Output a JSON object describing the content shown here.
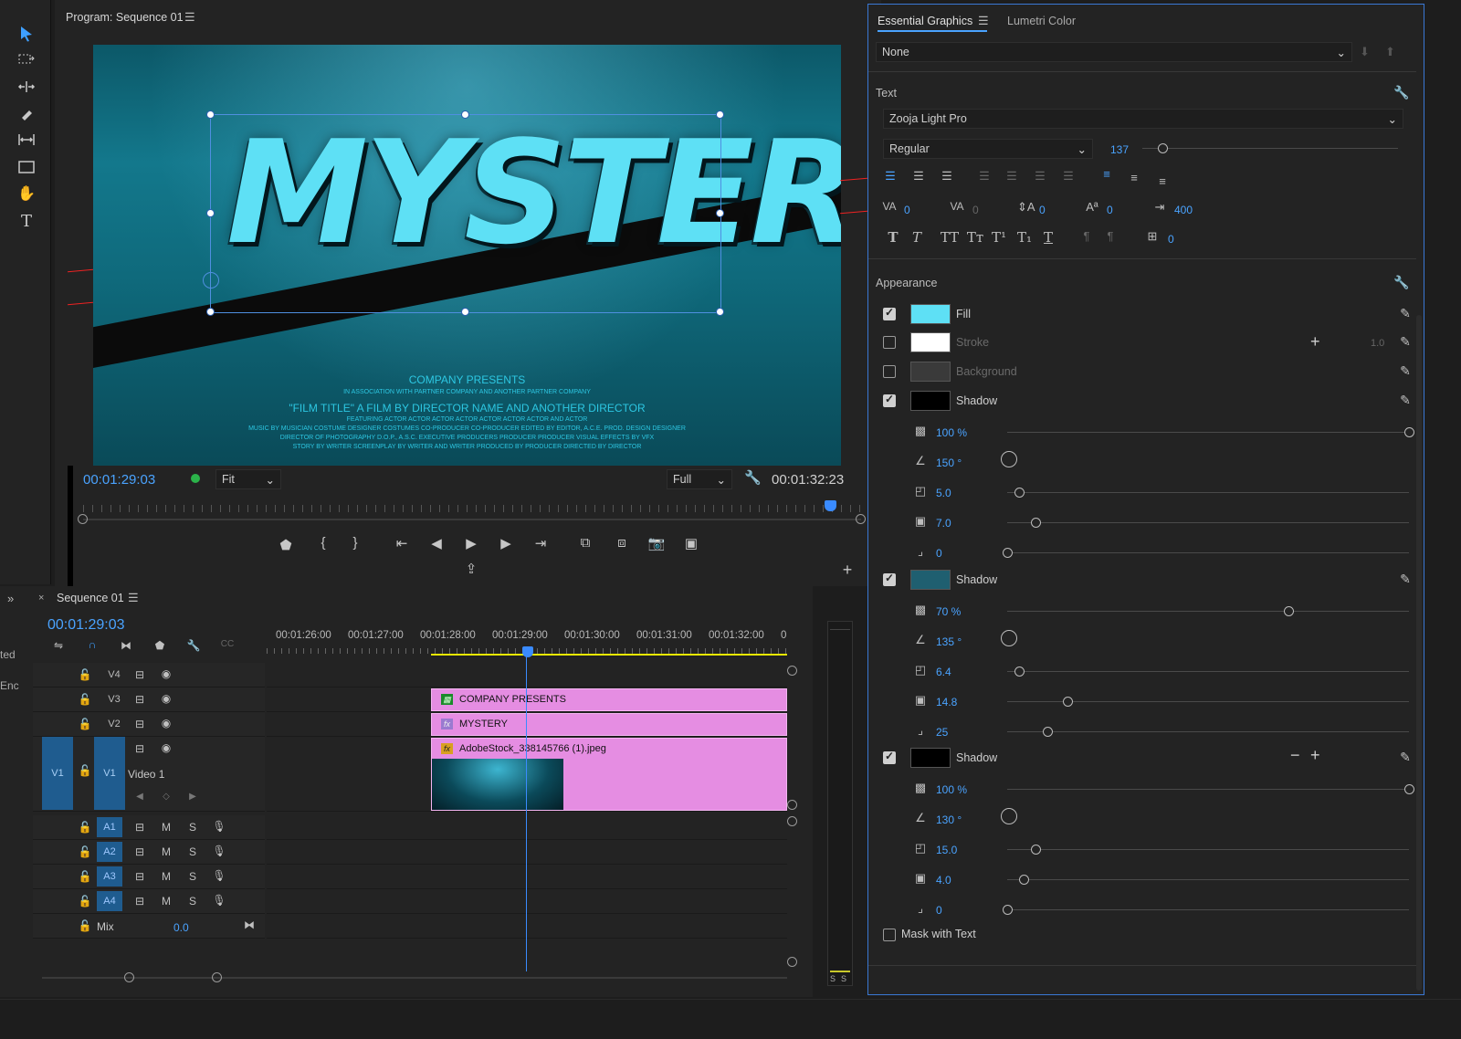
{
  "monitor": {
    "title": "Program: Sequence 01",
    "video_title": "MYSTERY",
    "credits": {
      "l1": "COMPANY PRESENTS",
      "l2": "IN ASSOCIATION WITH PARTNER COMPANY AND ANOTHER PARTNER COMPANY",
      "l3": "\"FILM TITLE\" A FILM BY DIRECTOR NAME AND ANOTHER DIRECTOR",
      "l4": "FEATURING ACTOR ACTOR ACTOR ACTOR ACTOR ACTOR ACTOR AND ACTOR",
      "l5": "MUSIC BY MUSICIAN COSTUME DESIGNER COSTUMES CO-PRODUCER CO-PRODUCER EDITED BY EDITOR, A.C.E.   PROD. DESIGN DESIGNER",
      "l6": "DIRECTOR OF PHOTOGRAPHY D.O.P., A.S.C.  EXECUTIVE PRODUCERS PRODUCER PRODUCER VISUAL EFFECTS BY VFX",
      "l7": "STORY BY WRITER SCREENPLAY BY WRITER AND WRITER PRODUCED BY PRODUCER DIRECTED BY DIRECTOR"
    },
    "timecode_current": "00:01:29:03",
    "zoom": "Fit",
    "quality": "Full",
    "timecode_duration": "00:01:32:23"
  },
  "timeline": {
    "title": "Sequence 01",
    "timecode": "00:01:29:03",
    "ruler": [
      "00:01:26:00",
      "00:01:27:00",
      "00:01:28:00",
      "00:01:29:00",
      "00:01:30:00",
      "00:01:31:00",
      "00:01:32:00",
      "0"
    ],
    "video_tracks": [
      "V4",
      "V3",
      "V2",
      "V1"
    ],
    "source_patch": "V1",
    "video1_name": "Video 1",
    "audio_tracks": [
      "A1",
      "A2",
      "A3",
      "A4"
    ],
    "audio_m": "M",
    "audio_s": "S",
    "mix_label": "Mix",
    "mix_value": "0.0",
    "clips": {
      "v3": "COMPANY PRESENTS",
      "v2": "MYSTERY",
      "v1": "AdobeStock_338145766 (1).jpeg"
    },
    "left_cut_1": "ted",
    "left_cut_2": "Enc",
    "meter_s1": "S",
    "meter_s2": "S"
  },
  "eg": {
    "tab_active": "Essential Graphics",
    "tab_other": "Lumetri Color",
    "style_select": "None",
    "text_section": "Text",
    "font": "Zooja Light Pro",
    "font_style": "Regular",
    "font_size": "137",
    "font_size_frac": 0.08,
    "kerning": "0",
    "tracking": "0",
    "leading": "0",
    "baseline": "0",
    "tab_width": "400",
    "tsume": "0",
    "appearance": "Appearance",
    "fill_label": "Fill",
    "stroke_label": "Stroke",
    "stroke_width": "1.0",
    "background_label": "Background",
    "shadow_label": "Shadow",
    "shadow1": {
      "opacity": "100 %",
      "angle": "150 °",
      "distance": "5.0",
      "size": "7.0",
      "blur": "0",
      "opacity_frac": 1.0,
      "distance_frac": 0.03,
      "size_frac": 0.07,
      "blur_frac": 0.0
    },
    "shadow2": {
      "opacity": "70 %",
      "angle": "135 °",
      "distance": "6.4",
      "size": "14.8",
      "blur": "25",
      "opacity_frac": 0.7,
      "distance_frac": 0.03,
      "size_frac": 0.15,
      "blur_frac": 0.1
    },
    "shadow3": {
      "opacity": "100 %",
      "angle": "130 °",
      "distance": "15.0",
      "size": "4.0",
      "blur": "0",
      "opacity_frac": 1.0,
      "distance_frac": 0.07,
      "size_frac": 0.04,
      "blur_frac": 0.0
    },
    "mask_label": "Mask with Text",
    "colors": {
      "fill": "#5ee0f5",
      "stroke": "#ffffff",
      "background": "#3a3a3a",
      "shadow1": "#000000",
      "shadow2": "#1f5f70",
      "shadow3": "#000000",
      "accent": "#4aa3ff"
    }
  }
}
